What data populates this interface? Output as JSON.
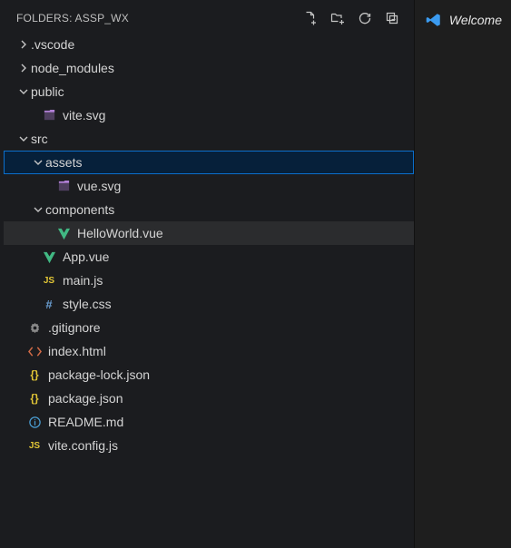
{
  "header": {
    "title_prefix": "FOLDERS: ",
    "project": "ASSP_WX"
  },
  "toolbar": {
    "new_file": "New File…",
    "new_folder": "New Folder…",
    "refresh": "Refresh Explorer",
    "collapse": "Collapse Folders"
  },
  "tree": {
    "vscode": ".vscode",
    "node_modules": "node_modules",
    "public": "public",
    "vite_svg": "vite.svg",
    "src": "src",
    "assets": "assets",
    "vue_svg": "vue.svg",
    "components": "components",
    "hello_world": "HelloWorld.vue",
    "app_vue": "App.vue",
    "main_js": "main.js",
    "style_css": "style.css",
    "gitignore": ".gitignore",
    "index_html": "index.html",
    "pkg_lock": "package-lock.json",
    "pkg": "package.json",
    "readme": "README.md",
    "vite_config": "vite.config.js"
  },
  "tab": {
    "welcome": "Welcome"
  },
  "icons": {
    "js": "JS",
    "hash": "#",
    "braces": "{}"
  },
  "colors": {
    "selection_border": "#0b6fcc",
    "selection_bg": "#06203a",
    "row_hover": "#2b2c2e"
  }
}
